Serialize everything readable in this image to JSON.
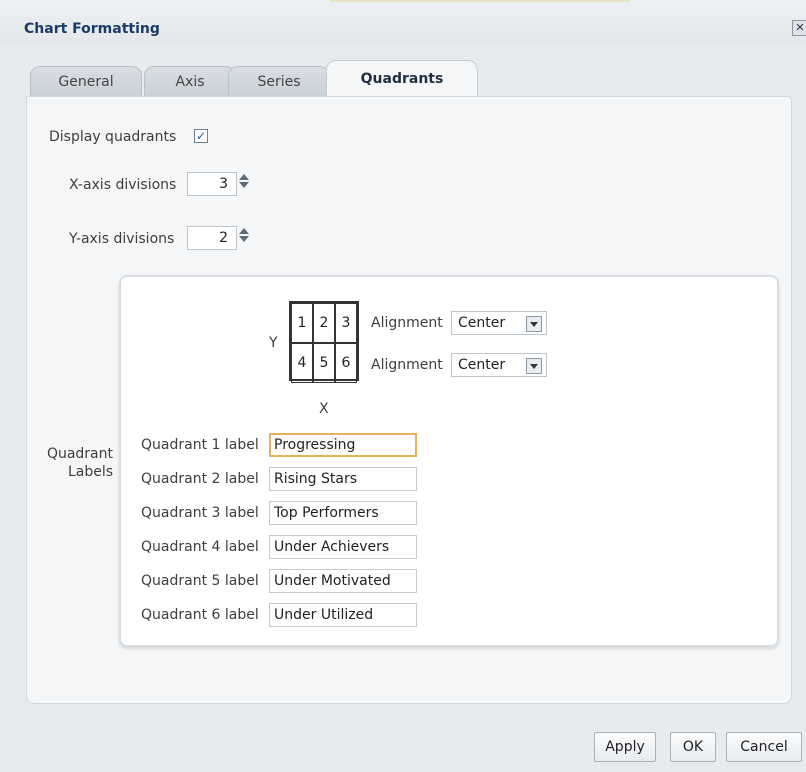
{
  "dialog": {
    "title": "Chart Formatting"
  },
  "tabs": [
    {
      "label": "General"
    },
    {
      "label": "Axis"
    },
    {
      "label": "Series"
    },
    {
      "label": "Quadrants",
      "active": true
    }
  ],
  "quadrants": {
    "display_label": "Display quadrants",
    "display_checked": true,
    "x_divisions_label": "X-axis divisions",
    "x_divisions_value": "3",
    "y_divisions_label": "Y-axis divisions",
    "y_divisions_value": "2",
    "section_label": "Quadrant Labels",
    "grid": {
      "cells": [
        "1",
        "2",
        "3",
        "4",
        "5",
        "6"
      ],
      "x_label": "X",
      "y_label": "Y"
    },
    "alignment_rows": [
      {
        "label": "Alignment",
        "value": "Center"
      },
      {
        "label": "Alignment",
        "value": "Center"
      }
    ],
    "labels": [
      {
        "label": "Quadrant 1 label",
        "value": "Progressing"
      },
      {
        "label": "Quadrant 2 label",
        "value": "Rising Stars"
      },
      {
        "label": "Quadrant 3 label",
        "value": "Top Performers"
      },
      {
        "label": "Quadrant 4 label",
        "value": "Under Achievers"
      },
      {
        "label": "Quadrant 5 label",
        "value": "Under Motivated"
      },
      {
        "label": "Quadrant 6 label",
        "value": "Under Utilized"
      }
    ]
  },
  "buttons": {
    "apply": "Apply",
    "ok": "OK",
    "cancel": "Cancel"
  },
  "icons": {
    "close": "close-icon",
    "checkbox": "checkmark-icon",
    "spinner": "spinner-arrows-icon",
    "dropdown": "chevron-down-icon"
  },
  "colors": {
    "title": "#1c3a66",
    "focus": "#e1b360",
    "check": "#2a5fa8"
  }
}
